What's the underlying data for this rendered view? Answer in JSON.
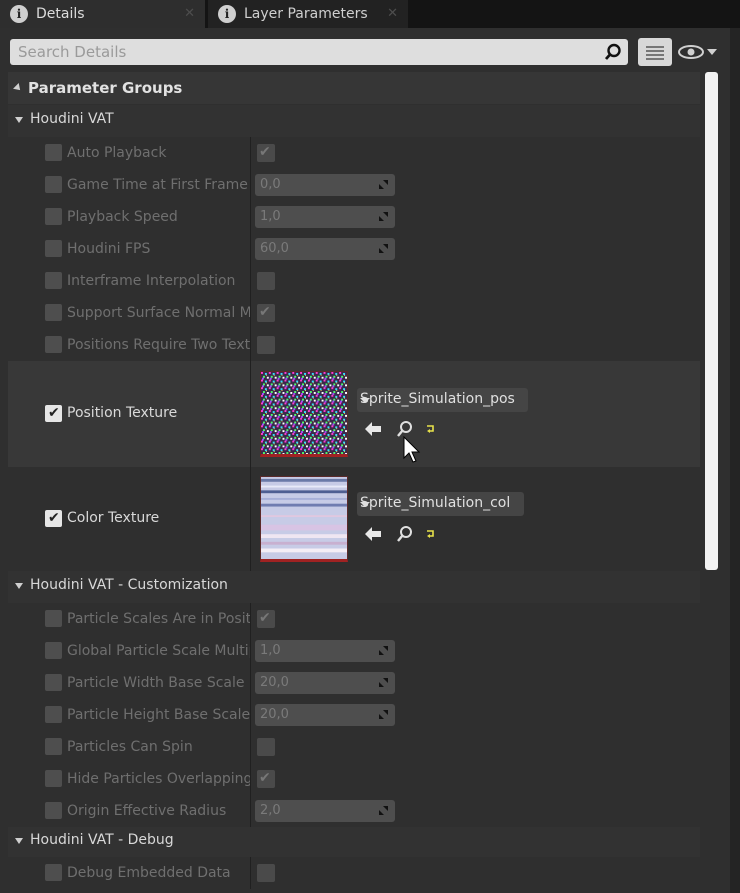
{
  "tabs": [
    {
      "label": "Details",
      "active": true
    },
    {
      "label": "Layer Parameters",
      "active": false
    }
  ],
  "search": {
    "placeholder": "Search Details"
  },
  "section_header": "Parameter Groups",
  "groups": [
    {
      "label": "Houdini VAT",
      "properties": [
        {
          "label": "Auto Playback",
          "value_type": "checkbox",
          "checked": true
        },
        {
          "label": "Game Time at First Frame",
          "value_type": "number",
          "value": "0,0"
        },
        {
          "label": "Playback Speed",
          "value_type": "number",
          "value": "1,0"
        },
        {
          "label": "Houdini FPS",
          "value_type": "number",
          "value": "60,0"
        },
        {
          "label": "Interframe Interpolation",
          "value_type": "checkbox",
          "checked": false
        },
        {
          "label": "Support Surface Normal Ma",
          "value_type": "checkbox",
          "checked": true
        },
        {
          "label": "Positions Require Two Text",
          "value_type": "checkbox",
          "checked": false
        },
        {
          "label": "Position Texture",
          "value_type": "texture",
          "asset": "Sprite_Simulation_pos",
          "enabled": true
        },
        {
          "label": "Color Texture",
          "value_type": "texture",
          "asset": "Sprite_Simulation_col",
          "enabled": true
        }
      ]
    },
    {
      "label": "Houdini VAT - Customization",
      "properties": [
        {
          "label": "Particle Scales Are in Posit",
          "value_type": "checkbox",
          "checked": true
        },
        {
          "label": "Global Particle Scale Multip",
          "value_type": "number",
          "value": "1,0"
        },
        {
          "label": "Particle Width Base Scale",
          "value_type": "number",
          "value": "20,0"
        },
        {
          "label": "Particle Height Base Scale",
          "value_type": "number",
          "value": "20,0"
        },
        {
          "label": "Particles Can Spin",
          "value_type": "checkbox",
          "checked": false
        },
        {
          "label": "Hide Particles Overlapping",
          "value_type": "checkbox",
          "checked": true
        },
        {
          "label": "Origin Effective Radius",
          "value_type": "number",
          "value": "2,0"
        }
      ]
    },
    {
      "label": "Houdini VAT - Debug",
      "properties": [
        {
          "label": "Debug Embedded Data",
          "value_type": "checkbox",
          "checked": false
        }
      ]
    }
  ],
  "icons": {
    "tab_icon": "info-icon",
    "search": "search-icon",
    "view_options": "list-view-icon",
    "visibility": "eye-icon",
    "use_selected": "arrow-left-icon",
    "browse": "browse-magnifier-icon",
    "reset": "reset-arrow-icon"
  }
}
